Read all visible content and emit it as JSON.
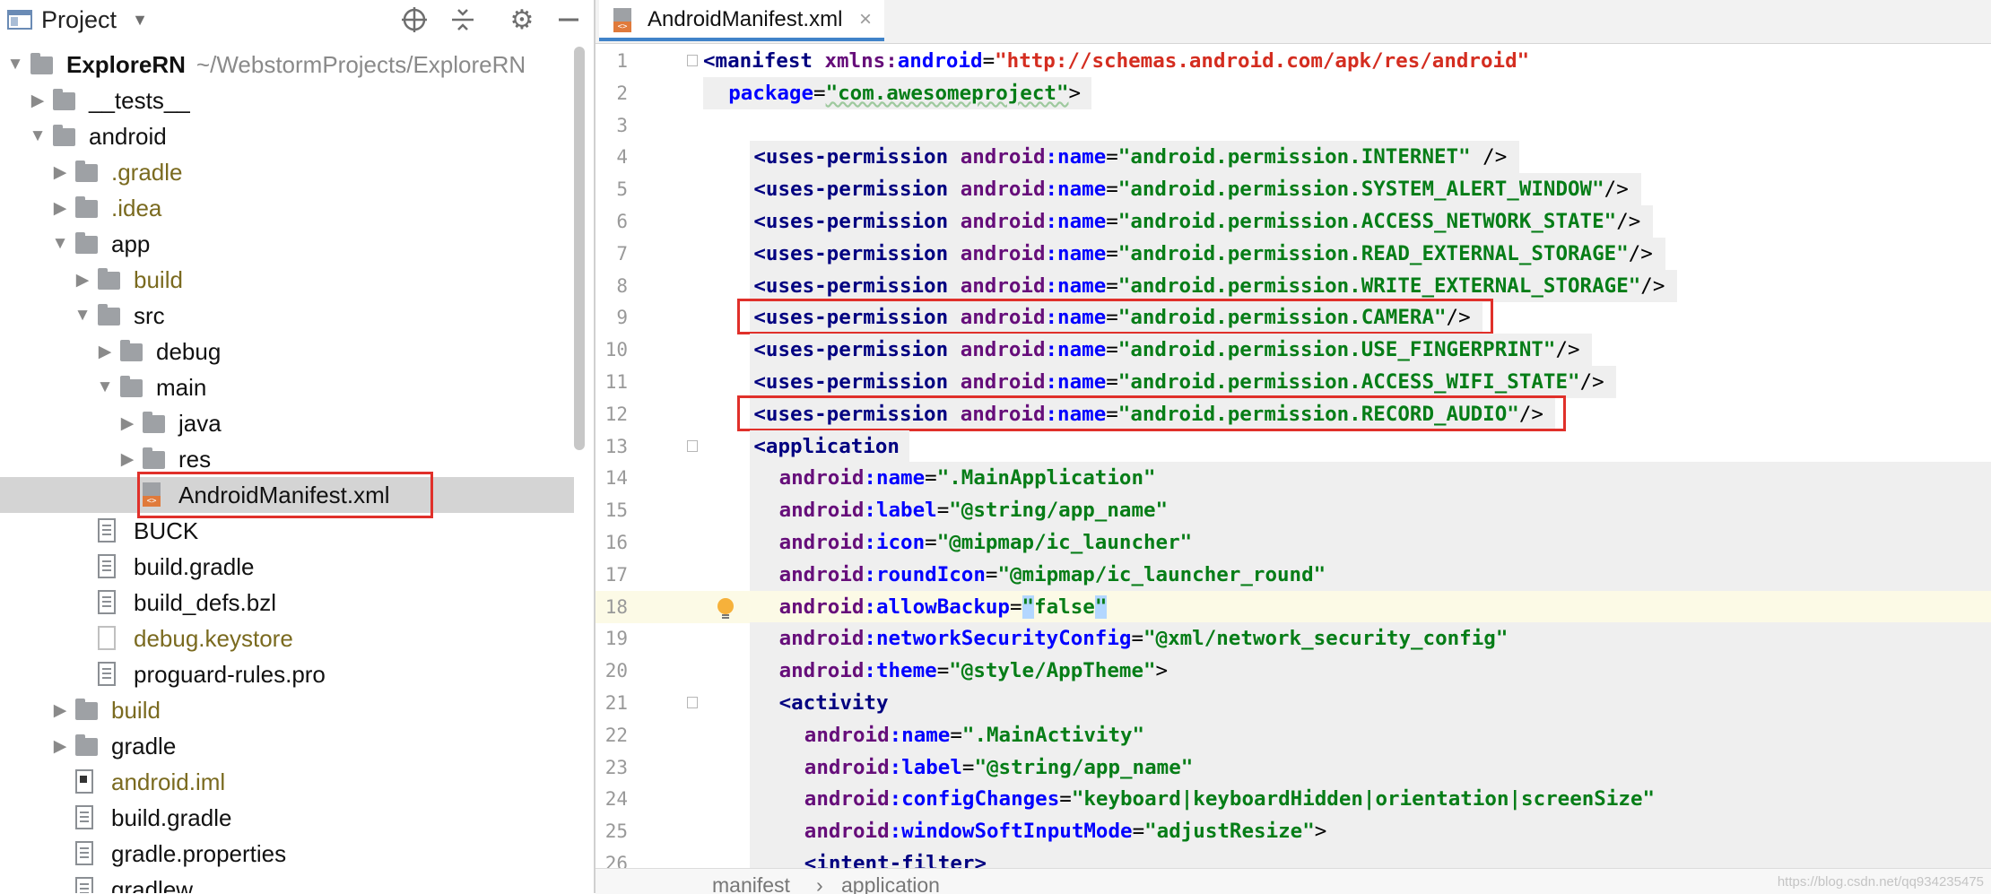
{
  "project_panel": {
    "title": "Project",
    "icons": [
      "project-view-icon",
      "dropdown-chevron-icon",
      "locate-target-icon",
      "collapse-all-icon",
      "gear-icon",
      "hide-panel-icon"
    ],
    "tree": [
      {
        "label": "ExploreRN",
        "path": "~/WebstormProjects/ExploreRN",
        "depth": 0,
        "kind": "folder",
        "arrow": "open",
        "style": "bold"
      },
      {
        "label": "__tests__",
        "depth": 1,
        "kind": "folder",
        "arrow": "closed"
      },
      {
        "label": "android",
        "depth": 1,
        "kind": "folder",
        "arrow": "open"
      },
      {
        "label": ".gradle",
        "depth": 2,
        "kind": "folder",
        "arrow": "closed",
        "style": "excluded"
      },
      {
        "label": ".idea",
        "depth": 2,
        "kind": "folder",
        "arrow": "closed",
        "style": "excluded"
      },
      {
        "label": "app",
        "depth": 2,
        "kind": "folder",
        "arrow": "open"
      },
      {
        "label": "build",
        "depth": 3,
        "kind": "folder",
        "arrow": "closed",
        "style": "excluded"
      },
      {
        "label": "src",
        "depth": 3,
        "kind": "folder",
        "arrow": "open"
      },
      {
        "label": "debug",
        "depth": 4,
        "kind": "folder",
        "arrow": "closed"
      },
      {
        "label": "main",
        "depth": 4,
        "kind": "folder",
        "arrow": "open"
      },
      {
        "label": "java",
        "depth": 5,
        "kind": "folder",
        "arrow": "closed"
      },
      {
        "label": "res",
        "depth": 5,
        "kind": "folder",
        "arrow": "closed"
      },
      {
        "label": "AndroidManifest.xml",
        "depth": 5,
        "kind": "xml",
        "selected": true
      },
      {
        "label": "BUCK",
        "depth": 3,
        "kind": "text"
      },
      {
        "label": "build.gradle",
        "depth": 3,
        "kind": "text"
      },
      {
        "label": "build_defs.bzl",
        "depth": 3,
        "kind": "text"
      },
      {
        "label": "debug.keystore",
        "depth": 3,
        "kind": "plain",
        "style": "excluded"
      },
      {
        "label": "proguard-rules.pro",
        "depth": 3,
        "kind": "text"
      },
      {
        "label": "build",
        "depth": 2,
        "kind": "folder",
        "arrow": "closed",
        "style": "excluded"
      },
      {
        "label": "gradle",
        "depth": 2,
        "kind": "folder",
        "arrow": "closed"
      },
      {
        "label": "android.iml",
        "depth": 2,
        "kind": "iml",
        "style": "excluded"
      },
      {
        "label": "build.gradle",
        "depth": 2,
        "kind": "text"
      },
      {
        "label": "gradle.properties",
        "depth": 2,
        "kind": "text"
      },
      {
        "label": "gradlew",
        "depth": 2,
        "kind": "text"
      }
    ]
  },
  "editor": {
    "tab": {
      "label": "AndroidManifest.xml",
      "close": "×",
      "icon": "xml-file-icon"
    },
    "current_line": 18,
    "lines": [
      {
        "n": "1",
        "indent": 0,
        "tokens": [
          [
            "tg",
            "<manifest "
          ],
          [
            "an",
            "xmlns:"
          ],
          [
            "at",
            "android"
          ],
          [
            "",
            "="
          ],
          [
            "url",
            "\"http://schemas.android.com/apk/res/android\""
          ]
        ]
      },
      {
        "n": "2",
        "indent": 1,
        "tokens": [
          [
            "at",
            "package"
          ],
          [
            "",
            "="
          ],
          [
            "pkgv",
            "\"com.awesomeproject\""
          ],
          [
            "",
            ">"
          ]
        ]
      },
      {
        "n": "3",
        "indent": 0,
        "tokens": []
      },
      {
        "n": "4",
        "indent": 2,
        "tokens": [
          [
            "tg",
            "<uses-permission "
          ],
          [
            "an",
            "android"
          ],
          [
            "at",
            ":name"
          ],
          [
            "",
            "="
          ],
          [
            "st",
            "\"android.permission.INTERNET\""
          ],
          [
            "",
            " />"
          ]
        ]
      },
      {
        "n": "5",
        "indent": 2,
        "tokens": [
          [
            "tg",
            "<uses-permission "
          ],
          [
            "an",
            "android"
          ],
          [
            "at",
            ":name"
          ],
          [
            "",
            "="
          ],
          [
            "st",
            "\"android.permission.SYSTEM_ALERT_WINDOW\""
          ],
          [
            "",
            "/>"
          ]
        ]
      },
      {
        "n": "6",
        "indent": 2,
        "tokens": [
          [
            "tg",
            "<uses-permission "
          ],
          [
            "an",
            "android"
          ],
          [
            "at",
            ":name"
          ],
          [
            "",
            "="
          ],
          [
            "st",
            "\"android.permission.ACCESS_NETWORK_STATE\""
          ],
          [
            "",
            "/>"
          ]
        ]
      },
      {
        "n": "7",
        "indent": 2,
        "tokens": [
          [
            "tg",
            "<uses-permission "
          ],
          [
            "an",
            "android"
          ],
          [
            "at",
            ":name"
          ],
          [
            "",
            "="
          ],
          [
            "st",
            "\"android.permission.READ_EXTERNAL_STORAGE\""
          ],
          [
            "",
            "/>"
          ]
        ]
      },
      {
        "n": "8",
        "indent": 2,
        "tokens": [
          [
            "tg",
            "<uses-permission "
          ],
          [
            "an",
            "android"
          ],
          [
            "at",
            ":name"
          ],
          [
            "",
            "="
          ],
          [
            "st",
            "\"android.permission.WRITE_EXTERNAL_STORAGE\""
          ],
          [
            "",
            "/>"
          ]
        ]
      },
      {
        "n": "9",
        "indent": 2,
        "tokens": [
          [
            "tg",
            "<uses-permission "
          ],
          [
            "an",
            "android"
          ],
          [
            "at",
            ":name"
          ],
          [
            "",
            "="
          ],
          [
            "st",
            "\"android.permission.CAMERA\""
          ],
          [
            "",
            "/>"
          ]
        ]
      },
      {
        "n": "10",
        "indent": 2,
        "tokens": [
          [
            "tg",
            "<uses-permission "
          ],
          [
            "an",
            "android"
          ],
          [
            "at",
            ":name"
          ],
          [
            "",
            "="
          ],
          [
            "st",
            "\"android.permission.USE_FINGERPRINT\""
          ],
          [
            "",
            "/>"
          ]
        ]
      },
      {
        "n": "11",
        "indent": 2,
        "tokens": [
          [
            "tg",
            "<uses-permission "
          ],
          [
            "an",
            "android"
          ],
          [
            "at",
            ":name"
          ],
          [
            "",
            "="
          ],
          [
            "st",
            "\"android.permission.ACCESS_WIFI_STATE\""
          ],
          [
            "",
            "/>"
          ]
        ]
      },
      {
        "n": "12",
        "indent": 2,
        "tokens": [
          [
            "tg",
            "<uses-permission "
          ],
          [
            "an",
            "android"
          ],
          [
            "at",
            ":name"
          ],
          [
            "",
            "="
          ],
          [
            "st",
            "\"android.permission.RECORD_AUDIO\""
          ],
          [
            "",
            "/>"
          ]
        ]
      },
      {
        "n": "13",
        "indent": 2,
        "tokens": [
          [
            "tg",
            "<application"
          ]
        ]
      },
      {
        "n": "14",
        "indent": 3,
        "tokens": [
          [
            "an",
            "android"
          ],
          [
            "at",
            ":name"
          ],
          [
            "",
            "="
          ],
          [
            "st",
            "\".MainApplication\""
          ]
        ]
      },
      {
        "n": "15",
        "indent": 3,
        "tokens": [
          [
            "an",
            "android"
          ],
          [
            "at",
            ":label"
          ],
          [
            "",
            "="
          ],
          [
            "st",
            "\"@string/app_name\""
          ]
        ]
      },
      {
        "n": "16",
        "indent": 3,
        "tokens": [
          [
            "an",
            "android"
          ],
          [
            "at",
            ":icon"
          ],
          [
            "",
            "="
          ],
          [
            "st",
            "\"@mipmap/ic_launcher\""
          ]
        ]
      },
      {
        "n": "17",
        "indent": 3,
        "tokens": [
          [
            "an",
            "android"
          ],
          [
            "at",
            ":roundIcon"
          ],
          [
            "",
            "="
          ],
          [
            "st",
            "\"@mipmap/ic_launcher_round\""
          ]
        ]
      },
      {
        "n": "18",
        "indent": 3,
        "tokens": [
          [
            "an",
            "android"
          ],
          [
            "at",
            ":allowBackup"
          ],
          [
            "",
            "="
          ],
          [
            "st-hl",
            "\""
          ],
          [
            "st",
            "false"
          ],
          [
            "st-hl",
            "\""
          ]
        ]
      },
      {
        "n": "19",
        "indent": 3,
        "tokens": [
          [
            "an",
            "android"
          ],
          [
            "at",
            ":networkSecurityConfig"
          ],
          [
            "",
            "="
          ],
          [
            "st",
            "\"@xml/network_security_config\""
          ]
        ]
      },
      {
        "n": "20",
        "indent": 3,
        "tokens": [
          [
            "an",
            "android"
          ],
          [
            "at",
            ":theme"
          ],
          [
            "",
            "="
          ],
          [
            "st",
            "\"@style/AppTheme\""
          ],
          [
            "",
            ">"
          ]
        ]
      },
      {
        "n": "21",
        "indent": 3,
        "tokens": [
          [
            "tg",
            "<activity"
          ]
        ]
      },
      {
        "n": "22",
        "indent": 4,
        "tokens": [
          [
            "an",
            "android"
          ],
          [
            "at",
            ":name"
          ],
          [
            "",
            "="
          ],
          [
            "st",
            "\".MainActivity\""
          ]
        ]
      },
      {
        "n": "23",
        "indent": 4,
        "tokens": [
          [
            "an",
            "android"
          ],
          [
            "at",
            ":label"
          ],
          [
            "",
            "="
          ],
          [
            "st",
            "\"@string/app_name\""
          ]
        ]
      },
      {
        "n": "24",
        "indent": 4,
        "tokens": [
          [
            "an",
            "android"
          ],
          [
            "at",
            ":configChanges"
          ],
          [
            "",
            "="
          ],
          [
            "st",
            "\"keyboard|keyboardHidden|orientation|screenSize\""
          ]
        ]
      },
      {
        "n": "25",
        "indent": 4,
        "tokens": [
          [
            "an",
            "android"
          ],
          [
            "at",
            ":windowSoftInputMode"
          ],
          [
            "",
            "="
          ],
          [
            "st",
            "\"adjustResize\""
          ],
          [
            "",
            ">"
          ]
        ]
      },
      {
        "n": "26",
        "indent": 4,
        "tokens": [
          [
            "tg",
            "<intent-filter>"
          ]
        ]
      }
    ],
    "highlighted_lines": [
      9,
      12
    ],
    "breadcrumb": [
      "manifest",
      "application"
    ],
    "breadcrumb_sep": "›"
  },
  "annotations": {
    "highlight_color": "#e0302a",
    "highlighted_tree_item": "AndroidManifest.xml"
  },
  "watermark": "https://blog.csdn.net/qq934235475",
  "colors": {
    "tag": "#000080",
    "namespace": "#660e7a",
    "attribute": "#0000ff",
    "string": "#067d17",
    "url": "#d42d20",
    "selection": "#d4d4d4",
    "current_line": "#fcfae6"
  }
}
